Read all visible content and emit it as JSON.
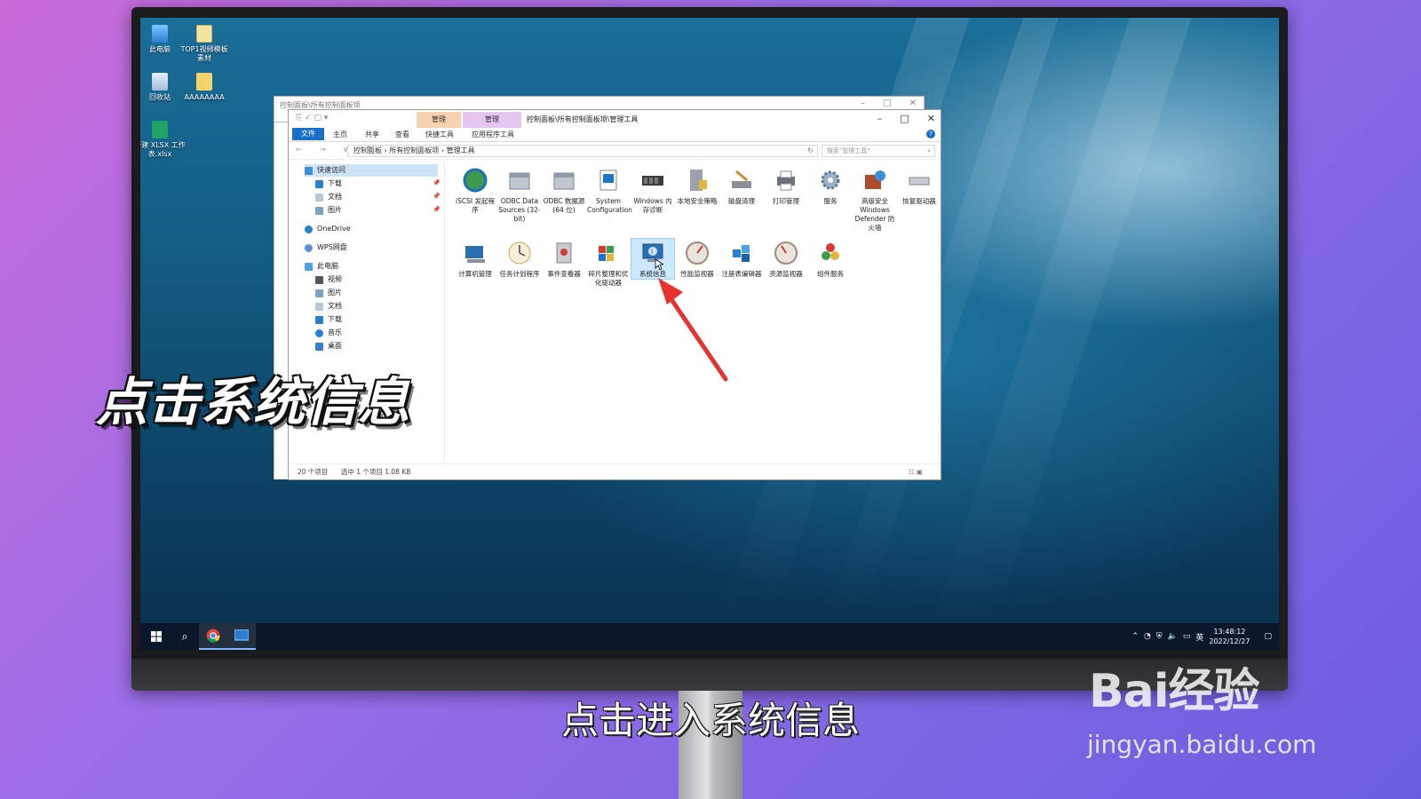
{
  "desktop": {
    "icons": [
      {
        "label": "此电脑"
      },
      {
        "label": "TOP1视频模板素材"
      },
      {
        "label": "回收站"
      },
      {
        "label": "AAAAAAAA"
      },
      {
        "label": "新建 XLSX 工作表.xlsx"
      }
    ]
  },
  "back_window": {
    "title": "控制面板\\所有控制面板项"
  },
  "window": {
    "context_tabs": [
      "管理",
      "管理"
    ],
    "title": "控制面板\\所有控制面板项\\管理工具",
    "ribbon_tabs": [
      "文件",
      "主页",
      "共享",
      "查看",
      "快捷工具",
      "应用程序工具"
    ],
    "address": [
      "控制面板",
      "所有控制面板项",
      "管理工具"
    ],
    "search_placeholder": "搜索\"管理工具\"",
    "nav": {
      "quick_access": "快速访问",
      "downloads": "下载",
      "documents": "文档",
      "pictures": "图片",
      "onedrive": "OneDrive",
      "wps": "WPS网盘",
      "this_pc": "此电脑",
      "videos": "视频",
      "pictures2": "图片",
      "documents2": "文档",
      "downloads2": "下载",
      "music": "音乐",
      "desktop": "桌面"
    },
    "tiles": [
      {
        "label": "iSCSI 发起程序"
      },
      {
        "label": "ODBC Data Sources (32-bit)"
      },
      {
        "label": "ODBC 数据源(64 位)"
      },
      {
        "label": "System Configuration"
      },
      {
        "label": "Windows 内存诊断"
      },
      {
        "label": "本地安全策略"
      },
      {
        "label": "磁盘清理"
      },
      {
        "label": "打印管理"
      },
      {
        "label": "服务"
      },
      {
        "label": "高级安全 Windows Defender 防火墙"
      },
      {
        "label": "恢复驱动器"
      },
      {
        "label": "计算机管理"
      },
      {
        "label": "任务计划程序"
      },
      {
        "label": "事件查看器"
      },
      {
        "label": "碎片整理和优化驱动器"
      },
      {
        "label": "系统信息"
      },
      {
        "label": "性能监视器"
      },
      {
        "label": "注册表编辑器"
      },
      {
        "label": "资源监视器"
      },
      {
        "label": "组件服务"
      }
    ],
    "status": {
      "count": "20 个项目",
      "selected": "选中 1 个项目  1.08 KB"
    }
  },
  "taskbar": {
    "lang": "英",
    "time": "13:48:12",
    "date": "2022/12/27"
  },
  "overlay": {
    "big_caption": "点击系统信息",
    "subtitle": "点击进入系统信息",
    "watermark_brand": "Bai经验",
    "watermark_url": "jingyan.baidu.com"
  },
  "colors": {
    "accent": "#1a6fc9",
    "arrow": "#e8322e",
    "selection": "#cce8ff"
  }
}
